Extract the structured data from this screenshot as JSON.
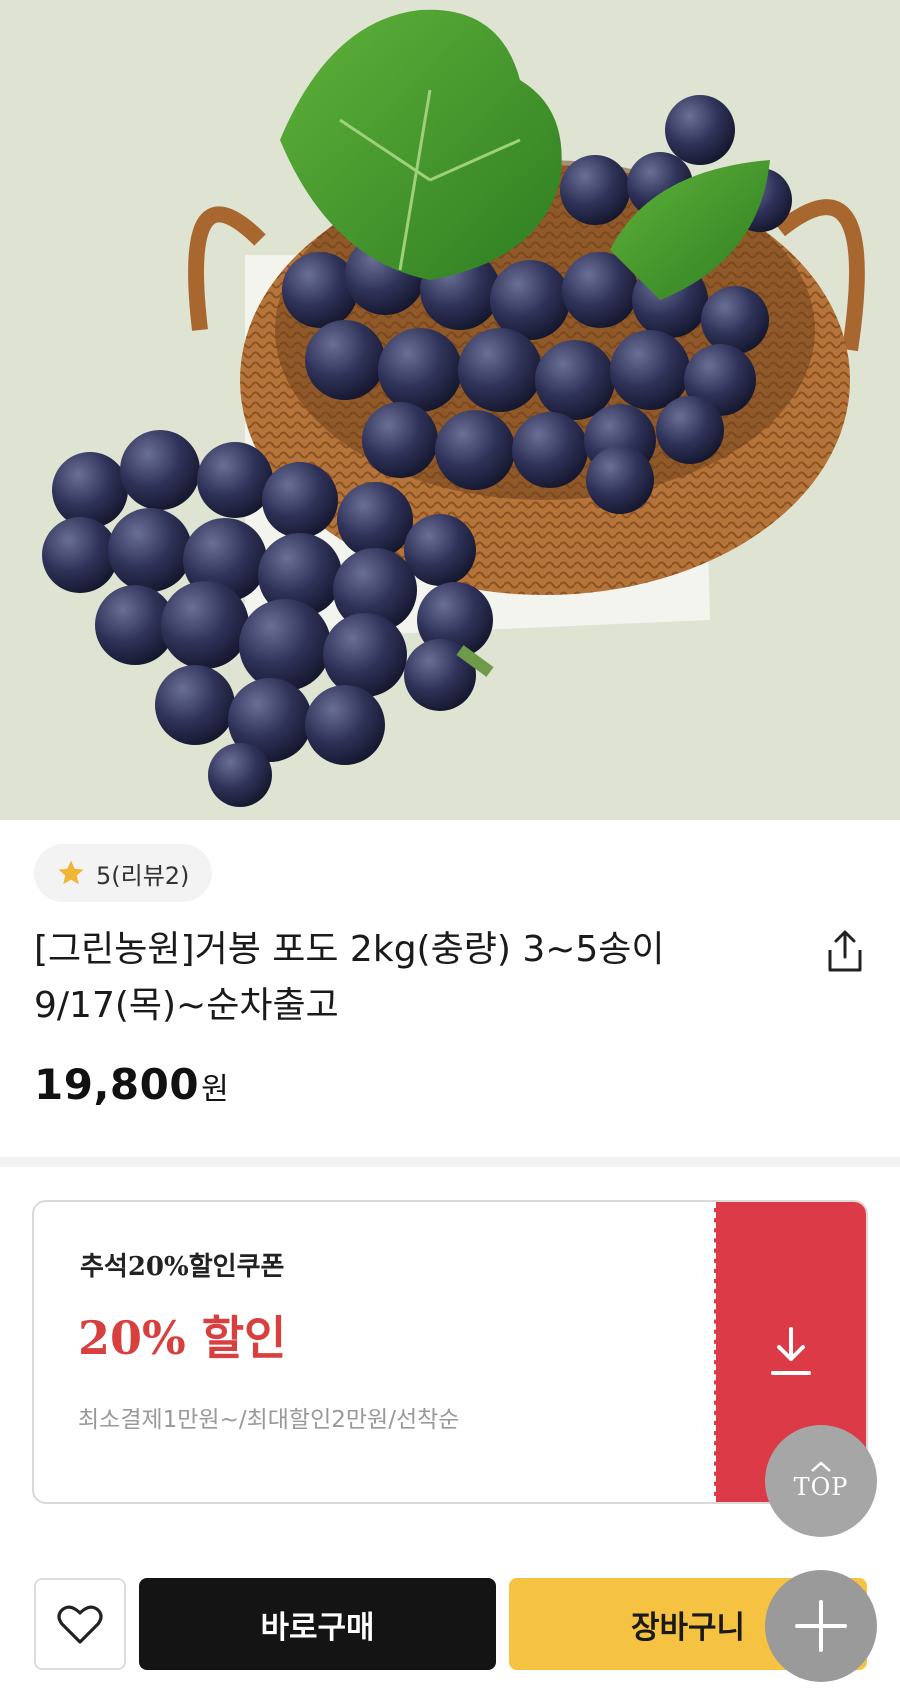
{
  "product": {
    "image_alt": "grapes in wicker basket",
    "rating_text": "5(리뷰2)",
    "title": "[그린농원]거봉 포도 2kg(충량) 3~5송이 9/17(목)~순차출고",
    "price": "19,800",
    "price_unit": "원"
  },
  "coupon": {
    "name": "추석20%할인쿠폰",
    "discount": "20% 할인",
    "conditions": "최소결제1만원~/최대할인2만원/선착순"
  },
  "floating": {
    "top_label": "TOP"
  },
  "actions": {
    "buy_now": "바로구매",
    "cart": "장바구니"
  },
  "colors": {
    "coupon_accent": "#dc3a47",
    "cart_button": "#f5c242",
    "buy_button": "#141414",
    "discount_text": "#d8403f",
    "star": "#f0b532"
  },
  "icons": [
    "star-icon",
    "share-icon",
    "download-icon",
    "chevron-up-icon",
    "plus-icon",
    "heart-icon"
  ]
}
